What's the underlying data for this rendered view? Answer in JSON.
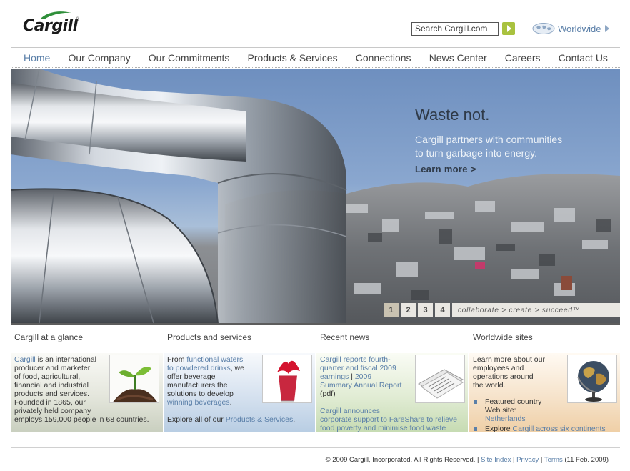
{
  "header": {
    "logo_text": "Cargill",
    "logo_mark": "®",
    "search_value": "Search Cargill.com",
    "worldwide_label": "Worldwide"
  },
  "nav": {
    "items": [
      "Home",
      "Our Company",
      "Our Commitments",
      "Products & Services",
      "Connections",
      "News Center",
      "Careers",
      "Contact Us"
    ],
    "active": "Home"
  },
  "hero": {
    "headline": "Waste not.",
    "sub_line1": "Cargill partners with communities",
    "sub_line2": "to turn garbage into energy.",
    "learn_more": "Learn more >",
    "pages": [
      "1",
      "2",
      "3",
      "4"
    ],
    "tagline": "collaborate  >  create  >  succeed™"
  },
  "columns": {
    "glance": {
      "heading": "Cargill at a glance",
      "link": "Cargill",
      "text1": " is an international",
      "line2": "producer and marketer",
      "line3": "of food, agricultural,",
      "line4": "financial and industrial",
      "line5": "products and services.",
      "line6": "Founded in 1865, our",
      "line7": "privately held company",
      "line8": "employs 159,000 people in 68 countries."
    },
    "products": {
      "heading": "Products and services",
      "from": "From ",
      "link1": "functional waters",
      "link2": "to powdered drinks",
      "comma_we": ", we",
      "line3": "offer beverage",
      "line4": "manufacturers the",
      "line5": "solutions to develop",
      "link3": "winning beverages",
      "period": ".",
      "explore": "Explore all of our ",
      "link4": "Products & Services",
      "period2": "."
    },
    "news": {
      "heading": "Recent news",
      "n1_line1": "Cargill reports fourth-",
      "n1_line2": "quarter and fiscal 2009",
      "n1_line3a": "earnings",
      "n1_sep": " | ",
      "n1_line3b": "2009",
      "n1_line4": "Summary Annual Report",
      "n1_pdf": "(pdf)",
      "n2_line1": "Cargill announces",
      "n2_line2": "corporate support to FareShare to relieve",
      "n2_line3": "food poverty and minimise food waste"
    },
    "worldwide": {
      "heading": "Worldwide sites",
      "line1": "Learn more about our",
      "line2": "employees and",
      "line3": "operations around",
      "line4": "the world.",
      "featured1": "Featured country",
      "featured2": "Web site:",
      "featured_link": "Netherlands",
      "explore": "Explore ",
      "explore_link": "Cargill across six continents"
    }
  },
  "footer": {
    "copyright": "© 2009 Cargill, Incorporated. All Rights Reserved.",
    "sep": " | ",
    "site_index": "Site Index",
    "privacy": "Privacy",
    "terms": "Terms",
    "date": " (11 Feb. 2009)"
  },
  "colors": {
    "link": "#5a7fa8",
    "search_go": "#a9c23f",
    "hero_sky": "#7b9bc8"
  }
}
